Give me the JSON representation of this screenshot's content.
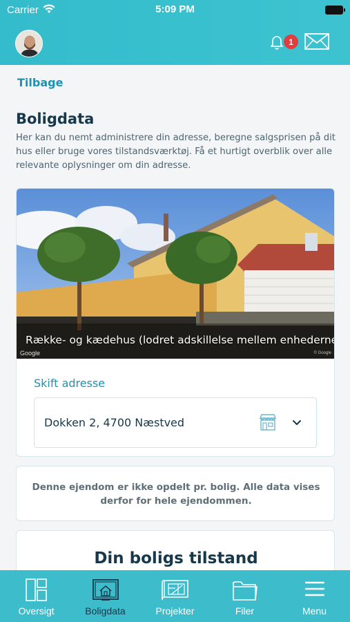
{
  "status_bar": {
    "carrier": "Carrier",
    "time": "5:09 PM"
  },
  "header": {
    "notification_count": "1",
    "icons": [
      "avatar",
      "bell-icon",
      "mail-icon"
    ]
  },
  "nav": {
    "back_label": "Tilbage"
  },
  "page": {
    "title": "Boligdata",
    "intro": "Her kan du nemt administrere din adresse, beregne salgsprisen på dit hus eller bruge vores tilstandsværktøj. Få et hurtigt overblik over alle relevante oplysninger om din adresse."
  },
  "property": {
    "photo_caption": "Række- og kædehus (lodret adskillelse mellem enhederne)",
    "photo_credit": "Google",
    "photo_copyright": "© Google",
    "change_address_label": "Skift adresse",
    "address_value": "Dokken 2, 4700 Næstved"
  },
  "notice": {
    "text": "Denne ejendom er ikke opdelt pr. bolig. Alle data vises derfor for hele ejendommen."
  },
  "condition": {
    "title": "Din boligs tilstand"
  },
  "tabs": [
    {
      "label": "Oversigt",
      "icon": "overview-icon",
      "active": false
    },
    {
      "label": "Boligdata",
      "icon": "house-data-icon",
      "active": true
    },
    {
      "label": "Projekter",
      "icon": "blueprint-icon",
      "active": false
    },
    {
      "label": "Filer",
      "icon": "folder-icon",
      "active": false
    },
    {
      "label": "Menu",
      "icon": "hamburger-icon",
      "active": false
    }
  ],
  "colors": {
    "header": "#3dc3d0",
    "accent": "#1b93b5",
    "active_tab": "#17384a",
    "badge": "#e23d3d"
  }
}
